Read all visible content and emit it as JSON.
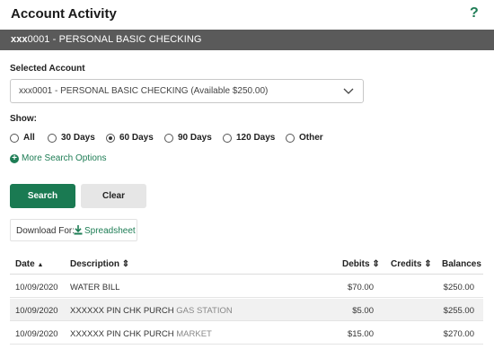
{
  "header": {
    "title": "Account Activity",
    "help_icon": "?"
  },
  "account_bar": {
    "masked": "xxx",
    "number": "0001 - PERSONAL BASIC CHECKING"
  },
  "selected_account": {
    "label": "Selected Account",
    "value": "xxx0001 - PERSONAL BASIC CHECKING (Available $250.00)"
  },
  "show": {
    "label": "Show:",
    "options": [
      {
        "label": "All",
        "selected": false
      },
      {
        "label": "30 Days",
        "selected": false
      },
      {
        "label": "60 Days",
        "selected": true
      },
      {
        "label": "90 Days",
        "selected": false
      },
      {
        "label": "120 Days",
        "selected": false
      },
      {
        "label": "Other",
        "selected": false
      }
    ]
  },
  "more_search": {
    "label": "More Search Options",
    "icon": "plus-circle-icon"
  },
  "buttons": {
    "search": "Search",
    "clear": "Clear"
  },
  "download": {
    "label": "Download For:",
    "link": "Spreadsheet",
    "icon": "download-icon"
  },
  "table": {
    "headers": {
      "date": "Date",
      "date_sort": "▲",
      "description": "Description",
      "debits": "Debits",
      "credits": "Credits",
      "balances": "Balances",
      "sort": "⇕"
    },
    "rows": [
      {
        "date": "10/09/2020",
        "desc_main": "WATER BILL",
        "desc_sub": "",
        "debit": "$70.00",
        "credit": "",
        "balance": "$250.00"
      },
      {
        "date": "10/09/2020",
        "desc_main": "XXXXXX PIN CHK PURCH",
        "desc_sub": "GAS STATION",
        "debit": "$5.00",
        "credit": "",
        "balance": "$255.00"
      },
      {
        "date": "10/09/2020",
        "desc_main": "XXXXXX PIN CHK PURCH",
        "desc_sub": "MARKET",
        "debit": "$15.00",
        "credit": "",
        "balance": "$270.00"
      }
    ]
  },
  "colors": {
    "accent": "#1e7d55",
    "bar": "#5a5a5a",
    "search_btn": "#1a7a52",
    "clear_btn": "#e6e6e6"
  }
}
